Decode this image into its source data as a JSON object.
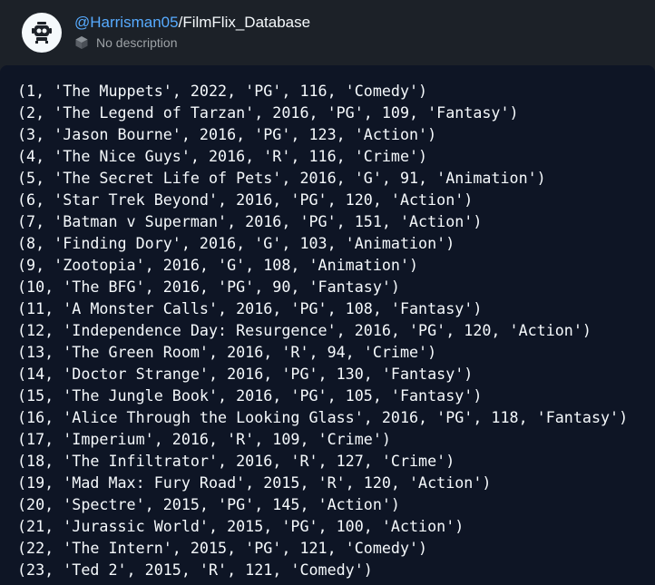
{
  "header": {
    "owner": "@Harrisman05",
    "separator": "/",
    "repl_name": "FilmFlix_Database",
    "description": "No description",
    "avatar_icon": "robot-avatar-icon",
    "description_icon": "package-icon"
  },
  "colors": {
    "owner_link": "#57abff",
    "background": "#1c2128",
    "console_background": "#0e1525",
    "text": "#f5f9fc",
    "muted": "#9da2a6"
  },
  "console": {
    "lines": [
      "(1, 'The Muppets', 2022, 'PG', 116, 'Comedy')",
      "(2, 'The Legend of Tarzan', 2016, 'PG', 109, 'Fantasy')",
      "(3, 'Jason Bourne', 2016, 'PG', 123, 'Action')",
      "(4, 'The Nice Guys', 2016, 'R', 116, 'Crime')",
      "(5, 'The Secret Life of Pets', 2016, 'G', 91, 'Animation')",
      "(6, 'Star Trek Beyond', 2016, 'PG', 120, 'Action')",
      "(7, 'Batman v Superman', 2016, 'PG', 151, 'Action')",
      "(8, 'Finding Dory', 2016, 'G', 103, 'Animation')",
      "(9, 'Zootopia', 2016, 'G', 108, 'Animation')",
      "(10, 'The BFG', 2016, 'PG', 90, 'Fantasy')",
      "(11, 'A Monster Calls', 2016, 'PG', 108, 'Fantasy')",
      "(12, 'Independence Day: Resurgence', 2016, 'PG', 120, 'Action')",
      "(13, 'The Green Room', 2016, 'R', 94, 'Crime')",
      "(14, 'Doctor Strange', 2016, 'PG', 130, 'Fantasy')",
      "(15, 'The Jungle Book', 2016, 'PG', 105, 'Fantasy')",
      "(16, 'Alice Through the Looking Glass', 2016, 'PG', 118, 'Fantasy')",
      "(17, 'Imperium', 2016, 'R', 109, 'Crime')",
      "(18, 'The Infiltrator', 2016, 'R', 127, 'Crime')",
      "(19, 'Mad Max: Fury Road', 2015, 'R', 120, 'Action')",
      "(20, 'Spectre', 2015, 'PG', 145, 'Action')",
      "(21, 'Jurassic World', 2015, 'PG', 100, 'Action')",
      "(22, 'The Intern', 2015, 'PG', 121, 'Comedy')",
      "(23, 'Ted 2', 2015, 'R', 121, 'Comedy')"
    ]
  }
}
